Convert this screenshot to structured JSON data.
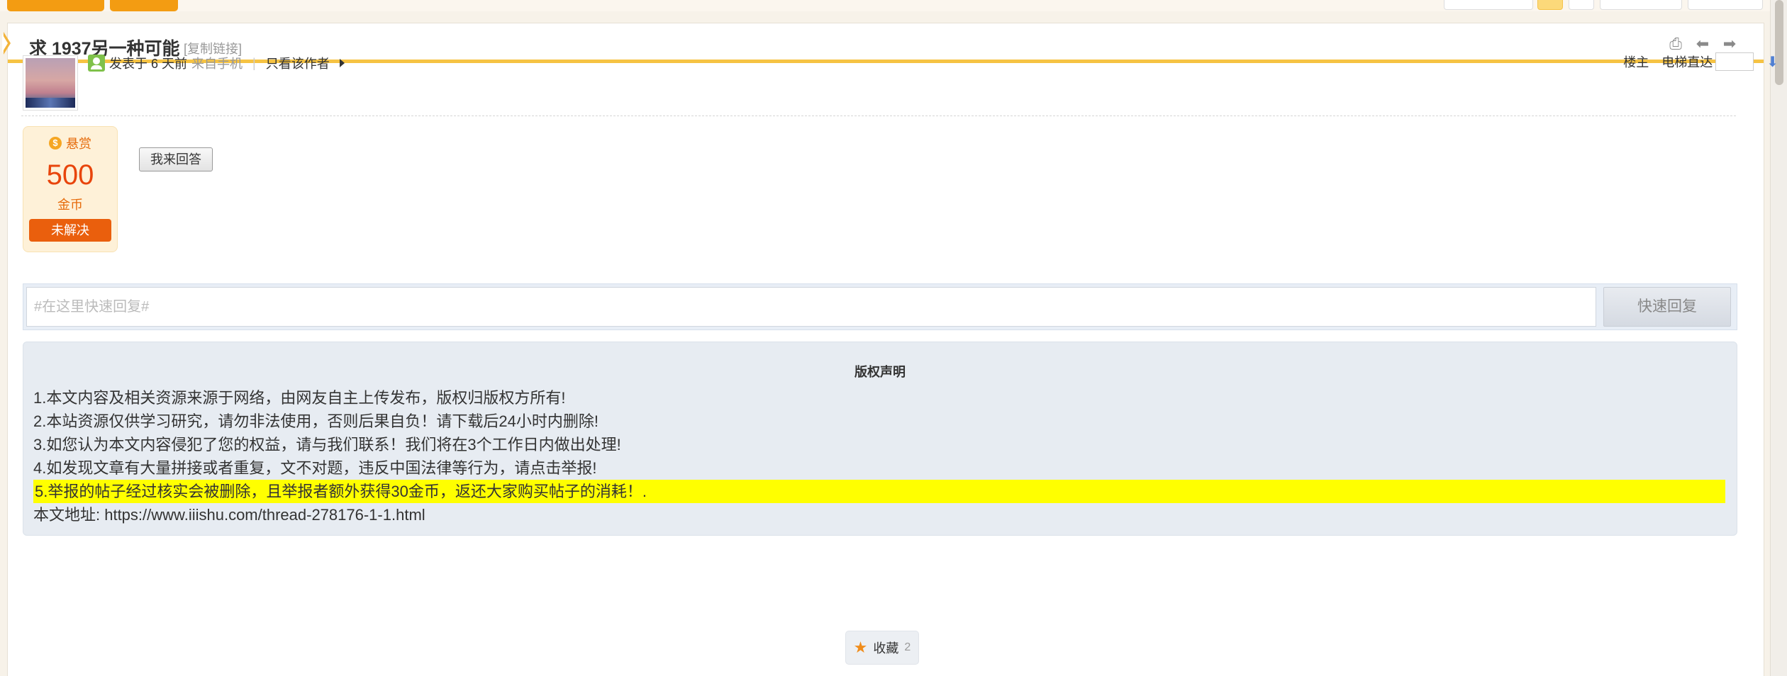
{
  "thread": {
    "title": "求 1937另一种可能",
    "copy_link_label": "[复制链接]"
  },
  "title_icons": [
    "print-icon",
    "prev-thread-icon",
    "next-thread-icon"
  ],
  "post_meta": {
    "posted": "发表于 6 天前",
    "from": "来自手机",
    "separator": "|",
    "author_only": "只看该作者"
  },
  "floor_nav": {
    "floor_label": "楼主",
    "jump_label": "电梯直达",
    "jump_value": ""
  },
  "reward": {
    "label": "悬赏",
    "amount": "500",
    "unit": "金币",
    "status": "未解决"
  },
  "answer_button": "我来回答",
  "quick_reply": {
    "placeholder": "#在这里快速回复#",
    "button": "快速回复"
  },
  "copyright": {
    "heading": "版权声明",
    "lines": [
      "1.本文内容及相关资源来源于网络，由网友自主上传发布，版权归版权方所有!",
      "2.本站资源仅供学习研究，请勿非法使用，否则后果自负！请下载后24小时内删除!",
      "3.如您认为本文内容侵犯了您的权益，请与我们联系！我们将在3个工作日内做出处理!",
      "4.如发现文章有大量拼接或者重复，文不对题，违反中国法律等行为，请点击举报!",
      "5.举报的帖子经过核实会被删除，且举报者额外获得30金币，返还大家购买帖子的消耗！.",
      "本文地址: https://www.iiishu.com/thread-278176-1-1.html"
    ]
  },
  "favorite": {
    "label": "收藏",
    "count": "2"
  },
  "colors": {
    "accent": "#f39c12",
    "title_underline": "#f6c343",
    "reward_status_bg": "#ea5f0d",
    "highlight": "#ffff00"
  }
}
